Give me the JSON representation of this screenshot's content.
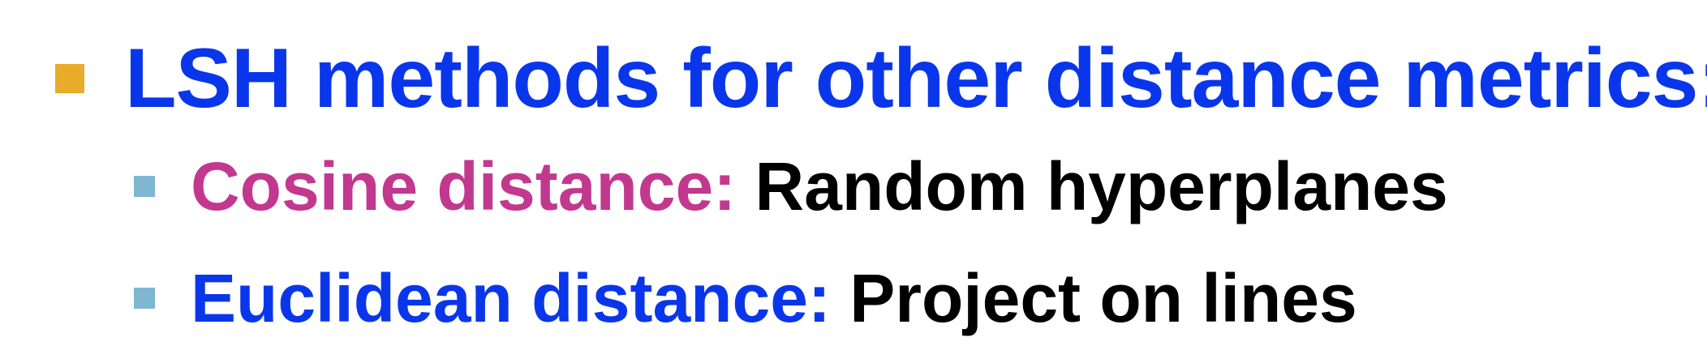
{
  "colors": {
    "bullet_l1": "#E8AC2A",
    "bullet_l2": "#7FB6D2",
    "blue": "#0A36EB",
    "magenta": "#C2388F",
    "black": "#000000"
  },
  "bullets": [
    {
      "text": "LSH methods for other distance metrics:"
    },
    {
      "term": "Cosine distance:",
      "detail": " Random hyperplanes"
    },
    {
      "term": "Euclidean distance:",
      "detail": " Project on lines"
    }
  ]
}
